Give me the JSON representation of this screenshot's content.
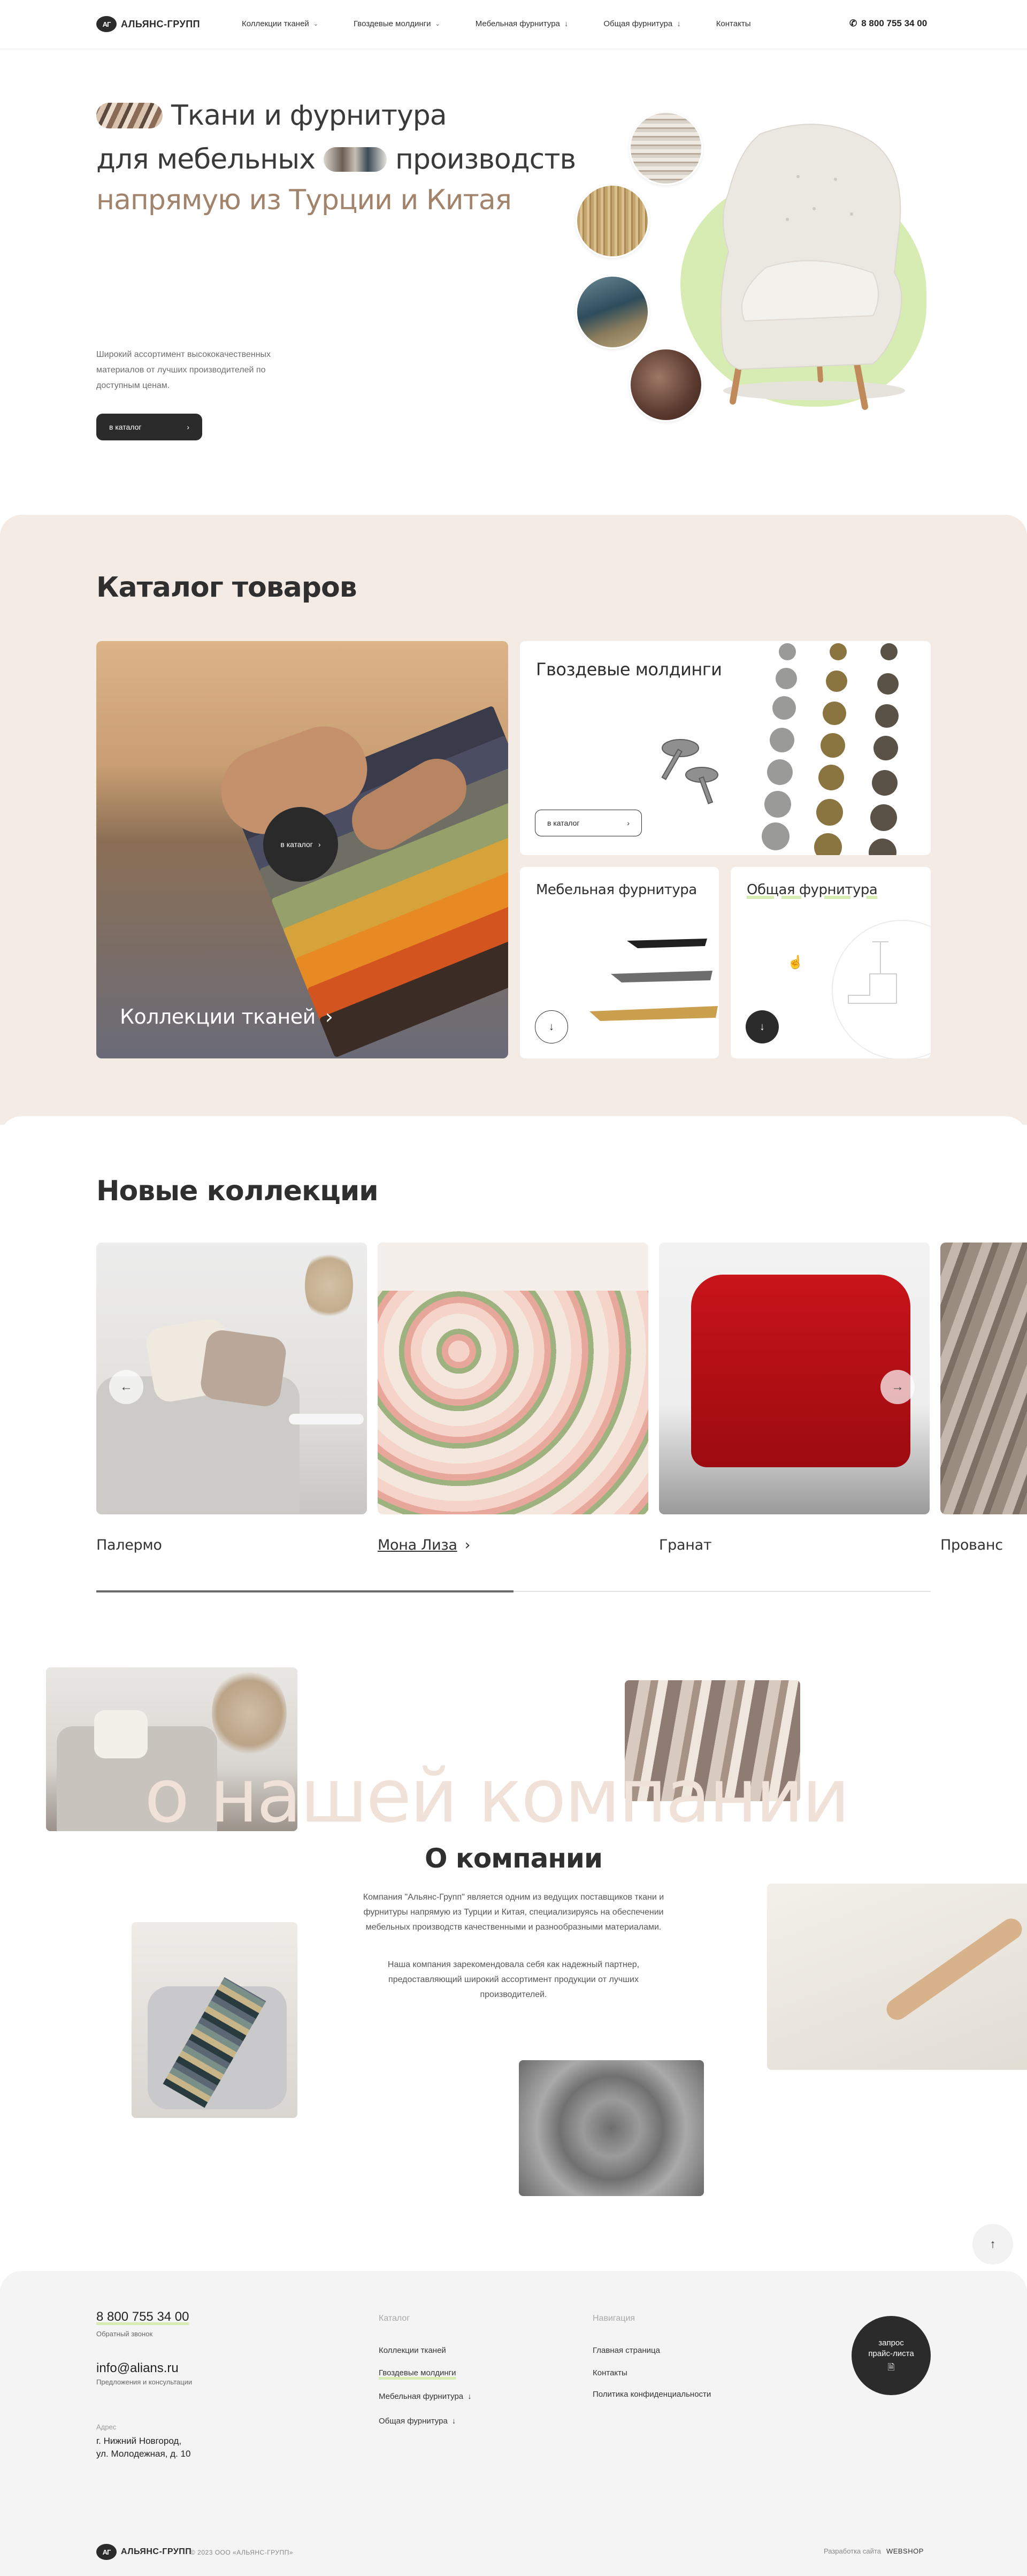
{
  "header": {
    "logo_mark": "АГ",
    "logo_text": "АЛЬЯНС-ГРУПП",
    "nav": [
      {
        "label": "Коллекции тканей",
        "icon": "chevron-down-icon"
      },
      {
        "label": "Гвоздевые молдинги",
        "icon": "chevron-down-icon"
      },
      {
        "label": "Мебельная фурнитура",
        "icon": "arrow-down-icon"
      },
      {
        "label": "Общая фурнитура",
        "icon": "arrow-down-icon"
      },
      {
        "label": "Контакты",
        "icon": ""
      }
    ],
    "phone": "8 800 755 34 00"
  },
  "hero": {
    "line1": "Ткани и фурнитура",
    "line2a": "для мебельных",
    "line2b": "производств",
    "line3": "напрямую из Турции и Китая",
    "description": "Широкий ассортимент высококачественных материалов от лучших производителей по доступным ценам.",
    "button": "в каталог",
    "accent_color": "#a2836b",
    "highlight_color": "#d7ecb2"
  },
  "catalog": {
    "title": "Каталог товаров",
    "fabrics": {
      "label": "Коллекции тканей",
      "button": "в каталог"
    },
    "moldings": {
      "title": "Гвоздевые молдинги",
      "button": "в каталог"
    },
    "furniture": {
      "title": "Мебельная фурнитура"
    },
    "general": {
      "title": "Общая фурнитура"
    },
    "bg_color": "#f4ebe4"
  },
  "collections": {
    "title": "Новые коллекции",
    "items": [
      {
        "name": "Палермо"
      },
      {
        "name": "Мона Лиза"
      },
      {
        "name": "Гранат"
      },
      {
        "name": "Прованс"
      }
    ],
    "progress": 0.5
  },
  "about": {
    "bg_text": "о нашей компании",
    "title": "О компании",
    "p1": "Компания \"Альянс-Групп\" является одним из ведущих поставщиков ткани и фурнитуры напрямую из Турции и Китая, специализируясь на обеспечении мебельных производств качественными и разнообразными материалами.",
    "p2": "Наша компания зарекомендовала себя как надежный партнер, предоставляющий широкий ассортимент продукции от лучших производителей."
  },
  "footer": {
    "phone": "8 800 755 34 00",
    "phone_note": "Обратный звонок",
    "email": "info@alians.ru",
    "email_note": "Предложения и консультации",
    "address_label": "Адрес",
    "address_line1": "г. Нижний Новгород,",
    "address_line2": "ул. Молодежная, д. 10",
    "catalog_head": "Каталог",
    "catalog_links": [
      "Коллекции тканей",
      "Гвоздевые молдинги",
      "Мебельная фурнитура",
      "Общая фурнитура"
    ],
    "nav_head": "Навигация",
    "nav_links": [
      "Главная страница",
      "Контакты",
      "Политика конфиденциальности"
    ],
    "price_line1": "запрос",
    "price_line2": "прайс-листа",
    "copyright": "© 2023 ООО «АЛЬЯНС-ГРУПП»",
    "dev_label": "Разработка сайта",
    "dev_name": "WEBSHOP"
  }
}
